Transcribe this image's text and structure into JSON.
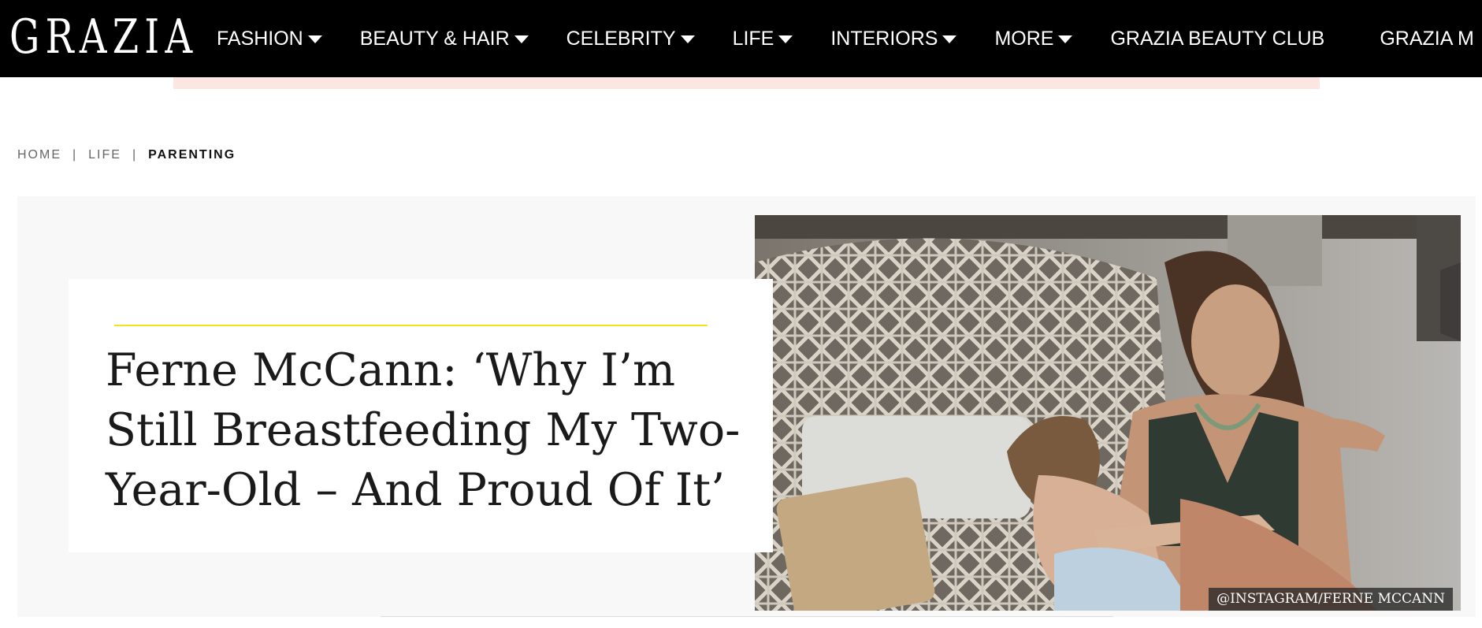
{
  "brand": {
    "logo_text": "GRAZIA"
  },
  "nav": {
    "items": [
      {
        "label": "FASHION",
        "has_dropdown": true
      },
      {
        "label": "BEAUTY & HAIR",
        "has_dropdown": true
      },
      {
        "label": "CELEBRITY",
        "has_dropdown": true
      },
      {
        "label": "LIFE",
        "has_dropdown": true
      },
      {
        "label": "INTERIORS",
        "has_dropdown": true
      },
      {
        "label": "MORE",
        "has_dropdown": true
      },
      {
        "label": "GRAZIA BEAUTY CLUB",
        "has_dropdown": false
      },
      {
        "label": "GRAZIA M",
        "has_dropdown": false
      }
    ]
  },
  "breadcrumb": {
    "items": [
      "HOME",
      "LIFE",
      "PARENTING"
    ],
    "separator": "|"
  },
  "article": {
    "title": "Ferne McCann: ‘Why I’m Still Breastfeeding My Two-Year-Old – And Proud Of It’",
    "image_credit": "@INSTAGRAM/FERNE MCCANN"
  },
  "colors": {
    "nav_bg": "#000000",
    "accent_rule": "#f2e51d",
    "ad_strip": "#fce6e1",
    "hero_bg": "#f8f8f8"
  }
}
